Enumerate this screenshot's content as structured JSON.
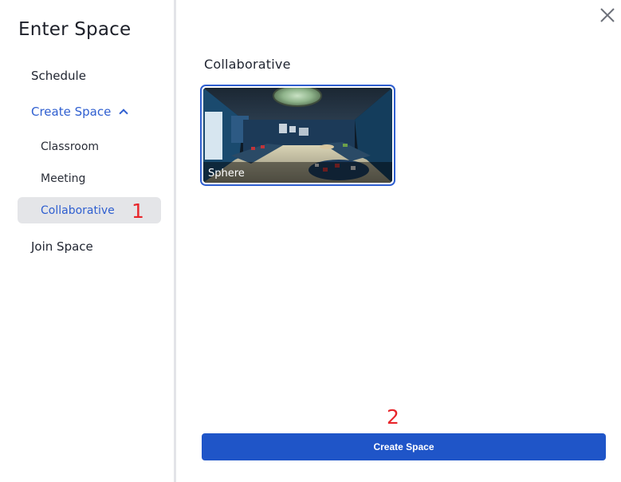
{
  "sidebar": {
    "title": "Enter Space",
    "items": {
      "schedule": "Schedule",
      "create_space": "Create Space",
      "classroom": "Classroom",
      "meeting": "Meeting",
      "collaborative": "Collaborative",
      "join_space": "Join Space"
    }
  },
  "annotations": {
    "first": "1",
    "second": "2"
  },
  "main": {
    "section_title": "Collaborative",
    "card": {
      "label": "Sphere"
    },
    "create_button": "Create Space"
  },
  "colors": {
    "accent": "#2f5fd0",
    "button": "#1f55c8",
    "annotation": "#e8252a",
    "selected_bg": "#e4e5e8"
  },
  "icons": {
    "close": "close-icon",
    "chevron": "chevron-up-icon"
  }
}
